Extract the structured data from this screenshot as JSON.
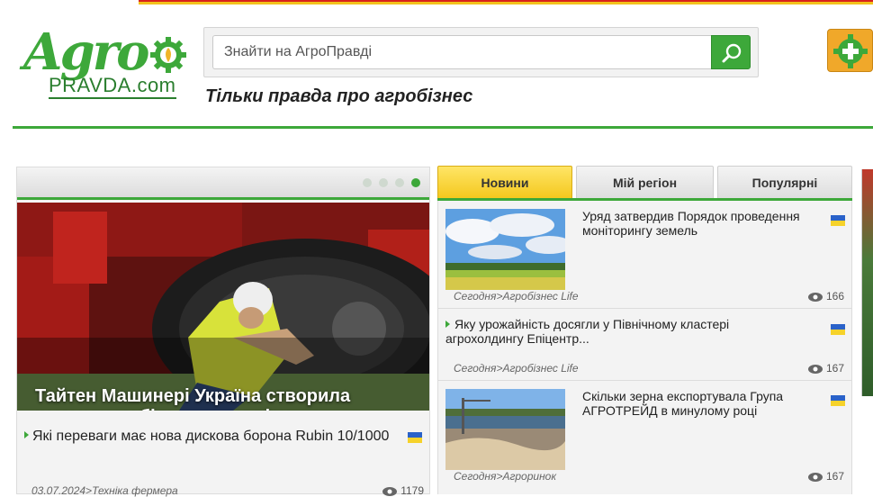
{
  "header": {
    "logo_main": "Agro",
    "logo_sub": "PRAVDA.com",
    "search_placeholder": "Знайти на АгроПравді",
    "tagline": "Тільки правда про агробізнес"
  },
  "colors": {
    "brand_green": "#3da83a",
    "tab_active": "#f4c81e",
    "add_button": "#f0a82a"
  },
  "slider": {
    "dots_total": 4,
    "active_dot": 4,
    "caption": "Тайтен Машинері Україна створила команду мобільного сервісу",
    "news_title": "Які переваги має нова дискова борона Rubin 10/1000",
    "news_meta": "03.07.2024>Техніка фермера",
    "news_views": "1179"
  },
  "tabs": [
    "Новини",
    "Мій регіон",
    "Популярні"
  ],
  "news": [
    {
      "title": "Уряд затвердив Порядок проведення моніторингу земель",
      "meta": "Сегодня>Агробізнес Life",
      "views": "166",
      "has_image": true,
      "image": "landscape-field-sky"
    },
    {
      "title": "Яку урожайність досягли у Північному кластері агрохолдингу Епіцентр...",
      "meta": "Сегодня>Агробізнес Life",
      "views": "167",
      "has_image": false
    },
    {
      "title": "Скільки зерна експортувала Група АГРОТРЕЙД в минулому році",
      "meta": "Сегодня>Агроринок",
      "views": "167",
      "has_image": true,
      "image": "grain-barge"
    }
  ]
}
